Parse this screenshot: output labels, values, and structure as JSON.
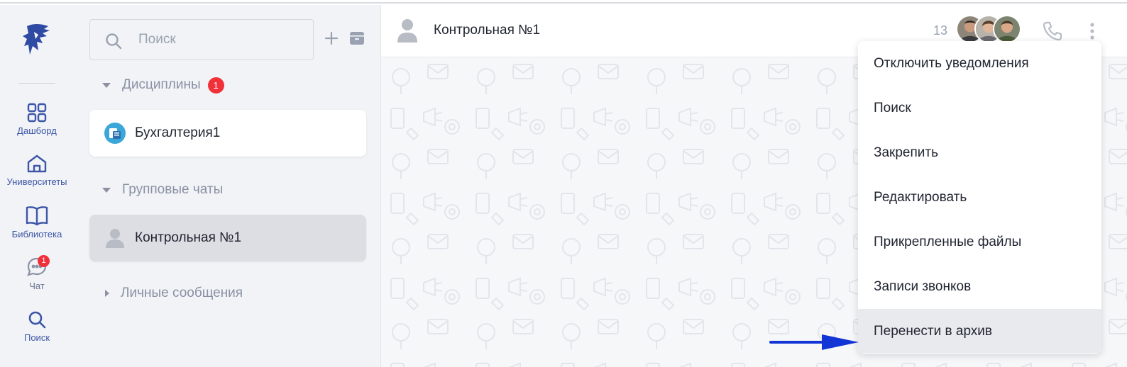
{
  "nav": {
    "items": [
      {
        "label": "Дашборд",
        "icon": "dashboard-grid-icon"
      },
      {
        "label": "Университеты",
        "icon": "university-house-icon"
      },
      {
        "label": "Библиотека",
        "icon": "library-book-icon"
      },
      {
        "label": "Чат",
        "icon": "chat-bubble-icon",
        "badge": "1"
      },
      {
        "label": "Поиск",
        "icon": "search-icon"
      }
    ]
  },
  "sidebar": {
    "search_placeholder": "Поиск",
    "sections": {
      "disciplines": {
        "label": "Дисциплины",
        "badge": "1"
      },
      "group_chats": {
        "label": "Групповые чаты"
      },
      "direct": {
        "label": "Личные сообщения"
      }
    },
    "chats": {
      "discipline_chat": "Бухгалтерия1",
      "group_chat": "Контрольная №1"
    }
  },
  "header": {
    "title": "Контрольная №1",
    "member_count": "13"
  },
  "menu": {
    "items": [
      "Отключить уведомления",
      "Поиск",
      "Закрепить",
      "Редактировать",
      "Прикрепленные файлы",
      "Записи звонков",
      "Перенести в архив"
    ],
    "highlighted_index": 6
  },
  "colors": {
    "accent": "#3d56a6",
    "badge": "#f0313a",
    "arrow": "#1235d6",
    "panel_bg": "#f1f3f7"
  }
}
